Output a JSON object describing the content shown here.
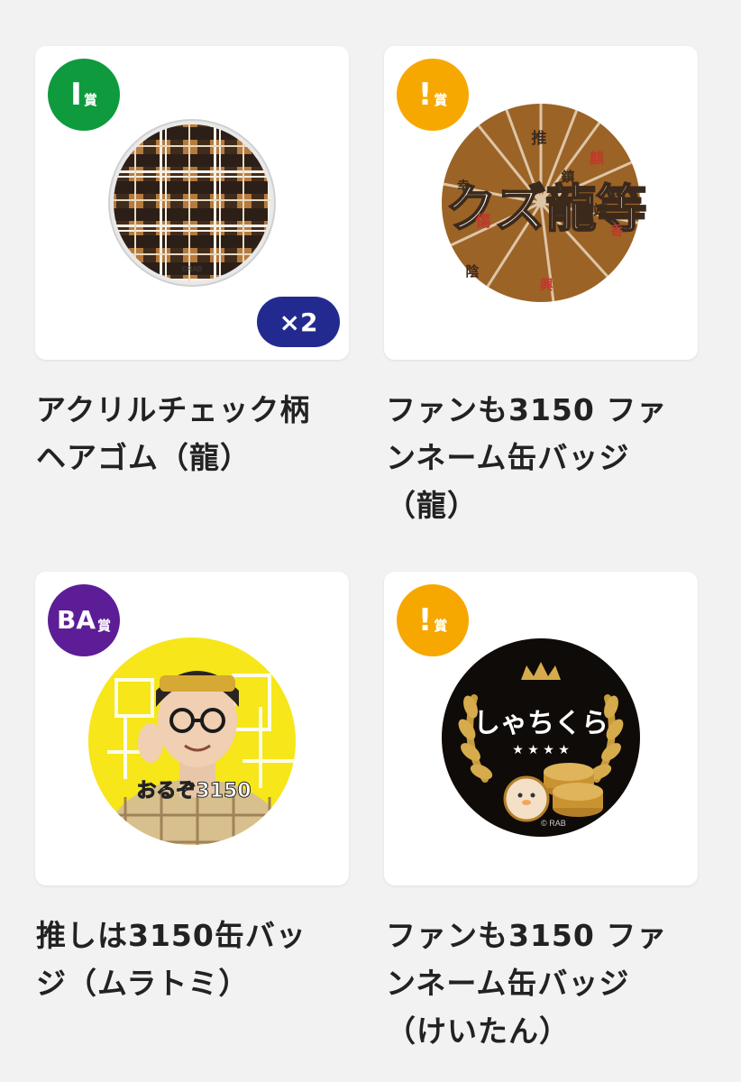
{
  "colors": {
    "badge_green": "#0f9a3e",
    "badge_orange": "#f7a800",
    "badge_purple": "#5d1d96",
    "quantity_pill": "#232a8f",
    "card_bg": "#ffffff",
    "page_bg": "#f2f2f2"
  },
  "items": [
    {
      "badge_big": "I",
      "badge_small": "賞",
      "quantity": "×2",
      "title": "アクリルチェック柄\nヘアゴム（龍）",
      "image_credit": "©RAB"
    },
    {
      "badge_big": "!",
      "badge_small": "賞",
      "title": "ファンも3150 ファ\nンネーム缶バッジ\n（龍）",
      "image_text_main": "クズ龍等",
      "image_kanji": [
        "推",
        "麒",
        "鎮",
        "傷",
        "靖",
        "香",
        "陰",
        "興",
        "幸"
      ]
    },
    {
      "badge_big": "BA",
      "badge_small": "賞",
      "title": "推しは3150缶バッ\nジ（ムラトミ）",
      "image_text": "おるぞ3150"
    },
    {
      "badge_big": "!",
      "badge_small": "賞",
      "title": "ファンも3150 ファ\nンネーム缶バッジ\n（けいたん）",
      "image_text": "しゃちくら",
      "image_credit": "© RAB"
    }
  ]
}
